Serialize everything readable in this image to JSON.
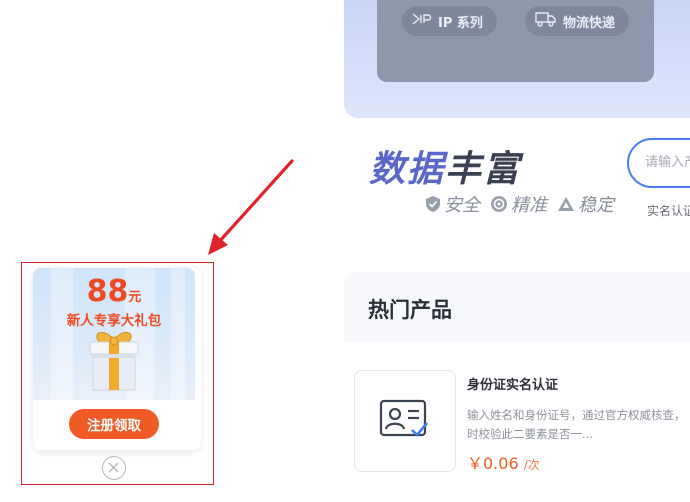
{
  "hero": {
    "tags": [
      {
        "label": "IP 系列",
        "icon": "ip-icon"
      },
      {
        "label": "物流快递",
        "icon": "truck-icon"
      }
    ]
  },
  "feature": {
    "title_accent": "数据",
    "title_rest": "丰富",
    "tags": [
      "安全",
      "精准",
      "稳定"
    ],
    "search_placeholder": "请输入产品",
    "subtext": "实名认证"
  },
  "hot": {
    "title": "热门产品",
    "product": {
      "name": "身份证实名认证",
      "desc_line1": "输入姓名和身份证号，通过官方权威核查，",
      "desc_line2": "时校验此二要素是否一...",
      "price": "￥0.06",
      "unit": "/次",
      "icon": "id-card-icon"
    }
  },
  "popup": {
    "amount": "88",
    "amount_unit": "元",
    "subtitle": "新人专享大礼包",
    "button": "注册领取",
    "close_icon": "close-icon",
    "accent": "#f05a24"
  }
}
